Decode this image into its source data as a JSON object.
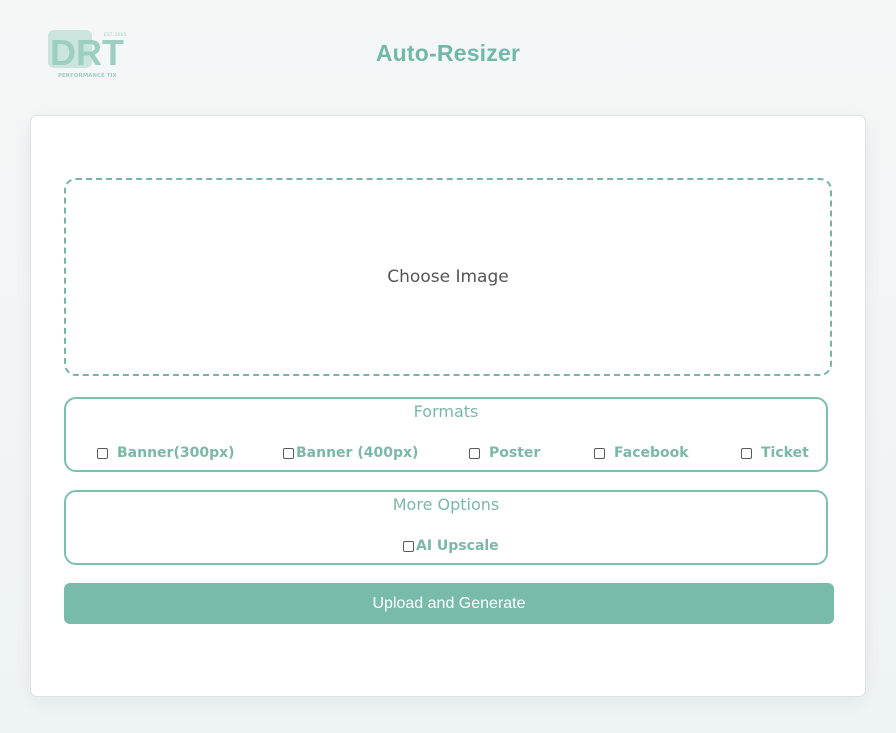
{
  "header": {
    "title": "Auto-Resizer",
    "logo": {
      "main_text": "DRT",
      "tagline": "PERFORMANCE TIX",
      "est": "EST. 2015"
    }
  },
  "uploader": {
    "choose_label": "Choose Image"
  },
  "formats": {
    "legend": "Formats",
    "items": [
      {
        "label": "Banner(300px)",
        "checked": false
      },
      {
        "label": "Banner (400px)",
        "checked": false
      },
      {
        "label": "Poster",
        "checked": false
      },
      {
        "label": "Facebook",
        "checked": false
      },
      {
        "label": "Ticket",
        "checked": false
      }
    ]
  },
  "more_options": {
    "legend": "More Options",
    "items": [
      {
        "label": "AI Upscale",
        "checked": false
      }
    ]
  },
  "submit": {
    "label": "Upload and Generate"
  },
  "colors": {
    "accent": "#78bbab",
    "accent_text": "#7ab8a8",
    "background": "#f3f6f6"
  }
}
